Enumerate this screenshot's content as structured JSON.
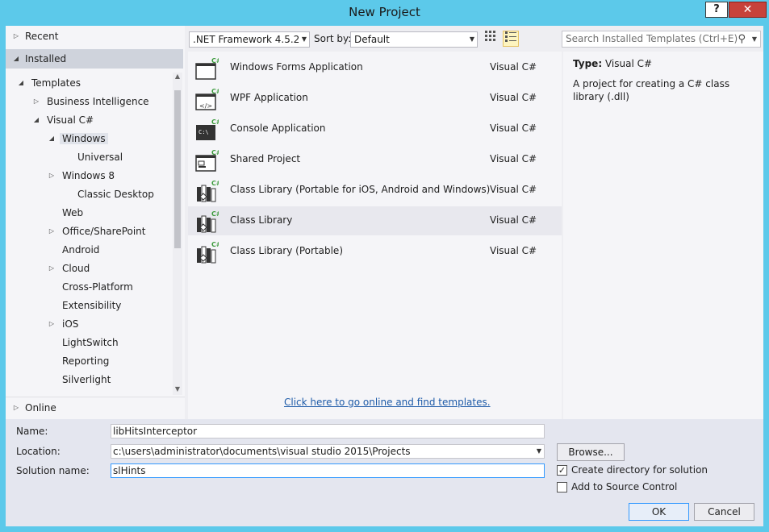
{
  "window": {
    "title": "New Project",
    "help_label": "?",
    "close_label": "✕"
  },
  "nav": {
    "recent": "Recent",
    "installed": "Installed",
    "online": "Online",
    "tree": [
      {
        "label": "Templates",
        "expander": "expanded"
      },
      {
        "label": "Business Intelligence",
        "expander": "collapsed"
      },
      {
        "label": "Visual C#",
        "expander": "expanded"
      },
      {
        "label": "Windows",
        "expander": "expanded",
        "selected": true
      },
      {
        "label": "Universal",
        "expander": "none"
      },
      {
        "label": "Windows 8",
        "expander": "collapsed"
      },
      {
        "label": "Classic Desktop",
        "expander": "none"
      },
      {
        "label": "Web",
        "expander": "none"
      },
      {
        "label": "Office/SharePoint",
        "expander": "collapsed"
      },
      {
        "label": "Android",
        "expander": "none"
      },
      {
        "label": "Cloud",
        "expander": "collapsed"
      },
      {
        "label": "Cross-Platform",
        "expander": "none"
      },
      {
        "label": "Extensibility",
        "expander": "none"
      },
      {
        "label": "iOS",
        "expander": "collapsed"
      },
      {
        "label": "LightSwitch",
        "expander": "none"
      },
      {
        "label": "Reporting",
        "expander": "none"
      },
      {
        "label": "Silverlight",
        "expander": "none"
      }
    ]
  },
  "toolbar": {
    "framework": ".NET Framework 4.5.2",
    "sort_label": "Sort by:",
    "sort_value": "Default",
    "search_placeholder": "Search Installed Templates (Ctrl+E)"
  },
  "templates": [
    {
      "name": "Windows Forms Application",
      "lang": "Visual C#",
      "icon": "windows-forms-icon"
    },
    {
      "name": "WPF Application",
      "lang": "Visual C#",
      "icon": "wpf-icon"
    },
    {
      "name": "Console Application",
      "lang": "Visual C#",
      "icon": "console-icon"
    },
    {
      "name": "Shared Project",
      "lang": "Visual C#",
      "icon": "shared-project-icon"
    },
    {
      "name": "Class Library (Portable for iOS, Android and Windows)",
      "lang": "Visual C#",
      "icon": "class-library-icon"
    },
    {
      "name": "Class Library",
      "lang": "Visual C#",
      "icon": "class-library-icon",
      "selected": true
    },
    {
      "name": "Class Library (Portable)",
      "lang": "Visual C#",
      "icon": "class-library-icon"
    }
  ],
  "online_link": "Click here to go online and find templates.",
  "description": {
    "type_label": "Type:",
    "type_value": "Visual C#",
    "text": "A project for creating a C# class library (.dll)"
  },
  "form": {
    "name_label": "Name:",
    "name_value": "libHitsInterceptor",
    "location_label": "Location:",
    "location_value": "c:\\users\\administrator\\documents\\visual studio 2015\\Projects",
    "solution_label": "Solution name:",
    "solution_value": "slHints",
    "browse_label": "Browse...",
    "create_dir_label": "Create directory for solution",
    "create_dir_checked": true,
    "source_control_label": "Add to Source Control",
    "source_control_checked": false,
    "ok_label": "OK",
    "cancel_label": "Cancel"
  },
  "colors": {
    "window_border": "#5cc9ea",
    "close_button": "#c7423a",
    "link": "#1e5ba8",
    "csharp_badge": "#3a9a3a"
  }
}
